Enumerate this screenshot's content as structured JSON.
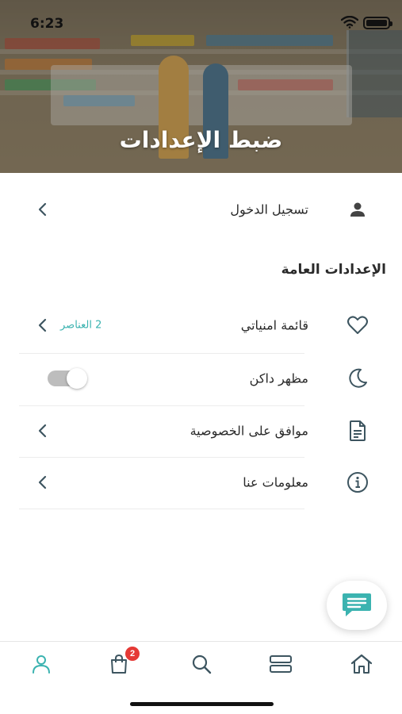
{
  "status_bar": {
    "time": "6:23"
  },
  "header": {
    "title": "ضبط الإعدادات"
  },
  "login": {
    "label": "تسجيل الدخول",
    "icon": "user-icon"
  },
  "general_settings": {
    "title": "الإعدادات العامة",
    "items": [
      {
        "label": "قائمة امنياتي",
        "value": "2 العناصر",
        "icon": "heart-icon"
      },
      {
        "label": "مظهر داكن",
        "icon": "moon-icon",
        "toggle_on": false
      },
      {
        "label": "موافق على الخصوصية",
        "icon": "document-icon"
      },
      {
        "label": "معلومات عنا",
        "icon": "info-icon"
      }
    ]
  },
  "bottom_nav": {
    "items": [
      {
        "name": "profile",
        "icon": "user-icon",
        "active": true
      },
      {
        "name": "cart",
        "icon": "bag-icon",
        "badge": "2"
      },
      {
        "name": "search",
        "icon": "search-icon"
      },
      {
        "name": "categories",
        "icon": "list-icon"
      },
      {
        "name": "home",
        "icon": "home-icon"
      }
    ]
  },
  "colors": {
    "accent": "#3bb3b0",
    "icon": "#3d5560",
    "badge": "#e53935"
  }
}
